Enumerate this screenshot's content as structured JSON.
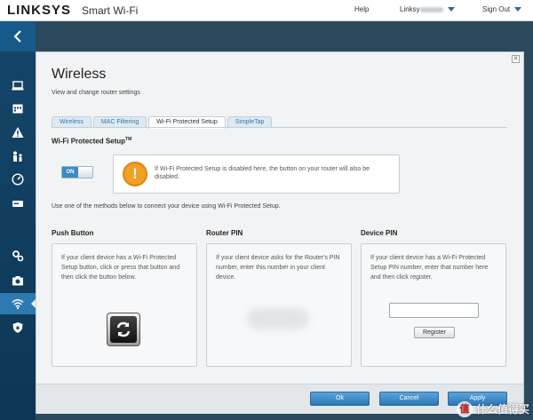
{
  "header": {
    "brand": "LINKSYS",
    "product": "Smart Wi-Fi",
    "help": "Help",
    "user_prefix": "Linksy",
    "sign_out": "Sign Out"
  },
  "sidebar": {
    "icons": [
      "chevron-left-icon",
      "laptop-icon",
      "calendar-icon",
      "alert-icon",
      "parental-icon",
      "speed-icon",
      "storage-icon",
      "settings-icon",
      "camera-icon",
      "wifi-icon",
      "shield-icon"
    ],
    "active": "wifi-icon"
  },
  "modal": {
    "title": "Wireless",
    "subtitle": "View and change router settings",
    "tabs": [
      {
        "label": "Wireless",
        "active": false
      },
      {
        "label": "MAC Filtering",
        "active": false
      },
      {
        "label": "Wi-Fi Protected Setup",
        "active": true
      },
      {
        "label": "SimpleTap",
        "active": false
      }
    ],
    "section_title": "Wi-Fi Protected Setup",
    "section_title_mark": "TM",
    "toggle_label": "ON",
    "warning": "If Wi-Fi Protected Setup is disabled here, the button on your router will also be disabled.",
    "intro": "Use one of the methods below to connect your device using Wi-Fi Protected Setup.",
    "methods": {
      "push_button": {
        "title": "Push Button",
        "text": "If your client device has a Wi-Fi Protected Setup button, click or press that button and then click the button below."
      },
      "router_pin": {
        "title": "Router PIN",
        "text": "If your client device asks for the Router's PIN number, enter this number in your client device."
      },
      "device_pin": {
        "title": "Device PIN",
        "text": "If your client device has a Wi-Fi Protected Setup PIN number, enter that number here and then click register.",
        "input_value": "",
        "register_label": "Register"
      }
    },
    "footer": {
      "ok": "Ok",
      "cancel": "Cancel",
      "apply": "Apply"
    }
  },
  "watermark": {
    "badge": "值",
    "text": "什么值得买"
  },
  "colors": {
    "accent": "#2b78b7",
    "warning": "#f0a024",
    "sidebar": "#14466a"
  }
}
